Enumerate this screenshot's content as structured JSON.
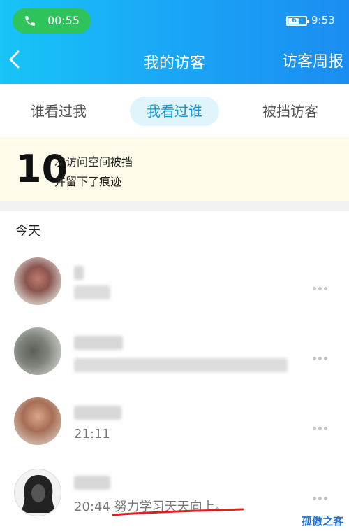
{
  "status_bar": {
    "call_time": "00:55",
    "battery_level": "61",
    "clock": "9:53"
  },
  "nav": {
    "title": "我的访客",
    "right_action": "访客周报"
  },
  "tabs": [
    {
      "label": "谁看过我",
      "active": false
    },
    {
      "label": "我看过谁",
      "active": true
    },
    {
      "label": "被挡访客",
      "active": false
    }
  ],
  "banner": {
    "count": "10",
    "line1": "次访问空间被挡",
    "line2": "并留下了痕迹"
  },
  "section": {
    "title": "今天"
  },
  "visits": [
    {
      "name": "",
      "info": ""
    },
    {
      "name": "",
      "info": ""
    },
    {
      "name": "",
      "info": "21:11"
    },
    {
      "name": "",
      "info": "20:44 努力学习天天向上。"
    }
  ],
  "watermark": "孤傲之客",
  "colors": {
    "accent": "#1aa0f5",
    "active_tab_text": "#1597d6",
    "call_green": "#2fc35b"
  }
}
